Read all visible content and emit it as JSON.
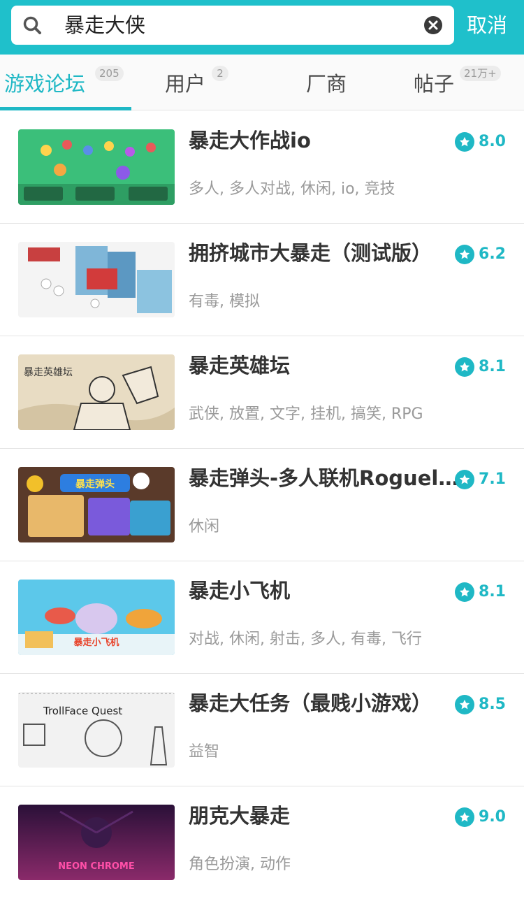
{
  "search": {
    "query": "暴走大侠",
    "cancel_label": "取消"
  },
  "tabs": [
    {
      "label": "游戏论坛",
      "badge": "205",
      "active": true
    },
    {
      "label": "用户",
      "badge": "2",
      "active": false
    },
    {
      "label": "厂商",
      "badge": "",
      "active": false
    },
    {
      "label": "帖子",
      "badge": "21万+",
      "active": false
    }
  ],
  "accent_color": "#1fb8c5",
  "games": [
    {
      "title": "暴走大作战io",
      "tags": "多人, 多人对战, 休闲, io, 竞技",
      "rating": "8.0"
    },
    {
      "title": "拥挤城市大暴走（测试版）",
      "tags": "有毒, 模拟",
      "rating": "6.2"
    },
    {
      "title": "暴走英雄坛",
      "tags": "武侠, 放置, 文字, 挂机, 搞笑, RPG",
      "rating": "8.1",
      "thumb_text": "暴走英雄坛"
    },
    {
      "title": "暴走弹头-多人联机Roguel...",
      "tags": "休闲",
      "rating": "7.1",
      "thumb_text": "暴走弹头"
    },
    {
      "title": "暴走小飞机",
      "tags": "对战, 休闲, 射击, 多人, 有毒, 飞行",
      "rating": "8.1",
      "thumb_text": "暴走小飞机"
    },
    {
      "title": "暴走大任务（最贱小游戏）",
      "tags": "益智",
      "rating": "8.5",
      "thumb_text": "TrollFace Quest"
    },
    {
      "title": "朋克大暴走",
      "tags": "角色扮演, 动作",
      "rating": "9.0",
      "thumb_text": "NEON CHROME"
    }
  ]
}
